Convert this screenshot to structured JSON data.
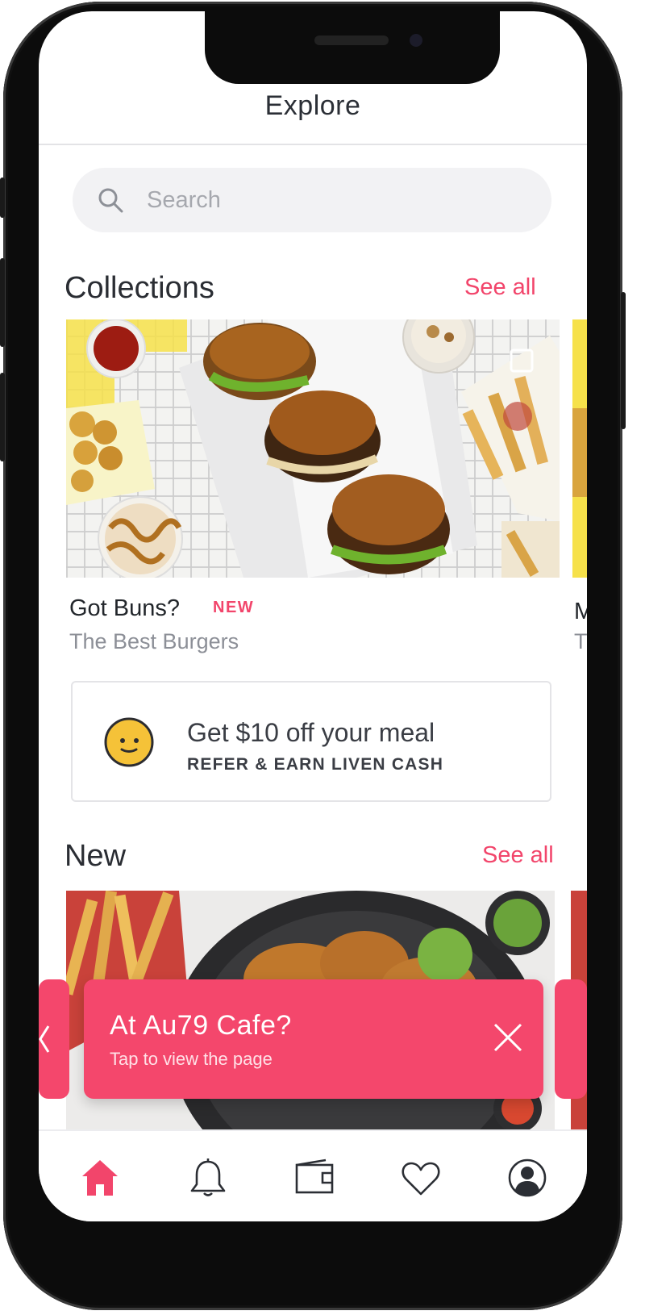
{
  "header": {
    "title": "Explore"
  },
  "search": {
    "placeholder": "Search",
    "icon": "search-icon"
  },
  "collections": {
    "title": "Collections",
    "see_all": "See all",
    "items": [
      {
        "title": "Got Buns?",
        "badge": "NEW",
        "subtitle": "The Best Burgers"
      },
      {
        "title": "M",
        "subtitle": "T"
      }
    ]
  },
  "promo": {
    "title": "Get $10 off your meal",
    "subtitle": "REFER & EARN LIVEN CASH",
    "icon": "smiley-icon",
    "face_color": "#f5c238"
  },
  "new_section": {
    "title": "New",
    "see_all": "See all"
  },
  "toast": {
    "title": "At Au79 Cafe?",
    "subtitle": "Tap to view the page",
    "color": "#f4476c"
  },
  "tabbar": {
    "items": [
      {
        "icon": "home-icon",
        "active": true
      },
      {
        "icon": "bell-icon"
      },
      {
        "icon": "wallet-icon"
      },
      {
        "icon": "heart-icon"
      },
      {
        "icon": "profile-icon"
      }
    ]
  },
  "colors": {
    "accent": "#f2456b",
    "text": "#2a2d33",
    "muted": "#8c8f97"
  }
}
